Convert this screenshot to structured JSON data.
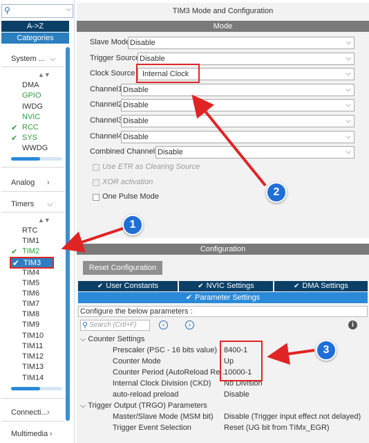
{
  "left": {
    "search": {
      "value": "",
      "placeholder": ""
    },
    "az_label": "A->Z",
    "categories_label": "Categories",
    "system_group": "System ...",
    "system_items": [
      "DMA",
      "GPIO",
      "IWDG",
      "NVIC",
      "RCC",
      "SYS",
      "WWDG"
    ],
    "analog_group": "Analog",
    "timers_group": "Timers",
    "timer_items": [
      "RTC",
      "TIM1",
      "TIM2",
      "TIM3",
      "TIM4",
      "TIM5",
      "TIM6",
      "TIM7",
      "TIM8",
      "TIM9",
      "TIM10",
      "TIM11",
      "TIM12",
      "TIM13",
      "TIM14"
    ],
    "connectivity_group": "Connecti...",
    "multimedia_group": "Multimedia"
  },
  "mode": {
    "window_title": "TIM3 Mode and Configuration",
    "section_title": "Mode",
    "fields": [
      {
        "label": "Slave Mode",
        "value": "Disable"
      },
      {
        "label": "Trigger Source",
        "value": "Disable"
      },
      {
        "label": "Clock Source",
        "value": "Internal Clock"
      },
      {
        "label": "Channel1",
        "value": "Disable"
      },
      {
        "label": "Channel2",
        "value": "Disable"
      },
      {
        "label": "Channel3",
        "value": "Disable"
      },
      {
        "label": "Channel4",
        "value": "Disable"
      },
      {
        "label": "Combined Channels",
        "value": "Disable"
      }
    ],
    "checkboxes": [
      {
        "label": "Use ETR as Clearing Source",
        "disabled": true
      },
      {
        "label": "XOR activation",
        "disabled": true
      },
      {
        "label": "One Pulse Mode",
        "disabled": false
      }
    ]
  },
  "config": {
    "section_title": "Configuration",
    "reset_button": "Reset Configuration",
    "tabs": [
      "User Constants",
      "NVIC Settings",
      "DMA Settings"
    ],
    "active_tab": "Parameter Settings",
    "hint": "Configure the below parameters :",
    "search_placeholder": "Search (Crtl+F)",
    "counter_settings": "Counter Settings",
    "params": [
      {
        "label": "Prescaler (PSC - 16 bits value)",
        "value": "8400-1"
      },
      {
        "label": "Counter Mode",
        "value": "Up"
      },
      {
        "label": "Counter Period (AutoReload Re...",
        "value": "10000-1"
      },
      {
        "label": "Internal Clock Division (CKD)",
        "value": "No Division"
      },
      {
        "label": "auto-reload preload",
        "value": "Disable"
      }
    ],
    "trigger_output": "Trigger Output (TRGO) Parameters",
    "trgo_params": [
      {
        "label": "Master/Slave Mode (MSM bit)",
        "value": "Disable (Trigger input effect not delayed)"
      },
      {
        "label": "Trigger Event Selection",
        "value": "Reset (UG bit from TIMx_EGR)"
      }
    ]
  },
  "annotations": {
    "badge1": "1",
    "badge2": "2",
    "badge3": "3",
    "color": "#e02424",
    "badge_color": "#1f6fd6"
  }
}
